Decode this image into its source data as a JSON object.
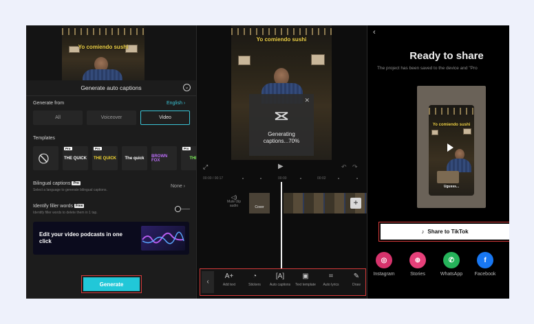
{
  "captions_panel": {
    "video_caption": "Yo comiendo sushi",
    "title": "Generate auto captions",
    "generate_from_label": "Generate from",
    "language": "English",
    "source_options": [
      "All",
      "Voiceover",
      "Video"
    ],
    "selected_source": "Video",
    "templates_label": "Templates",
    "templates": [
      {
        "text": "",
        "pro": false
      },
      {
        "text": "THE QUICK",
        "pro": true
      },
      {
        "text": "THE QUICK",
        "pro": true
      },
      {
        "text": "The quick",
        "pro": false
      },
      {
        "text": "BROWN FOX",
        "pro": false
      },
      {
        "text": "THE",
        "pro": true
      }
    ],
    "pro_badge": "Pro",
    "bilingual_label": "Bilingual captions",
    "bilingual_sub": "Select a language to generate bilingual captions.",
    "bilingual_value": "None",
    "filler_label": "Identify filler words",
    "free_badge": "Free",
    "filler_sub": "Identify filler words to delete them in 1 tap.",
    "filler_enabled": false,
    "promo_text": "Edit your video podcasts in one click",
    "generate_button": "Generate"
  },
  "editor_panel": {
    "video_caption": "Yo comiendo sushi",
    "generating_text": "Generating captions...70%",
    "generating_progress": 70,
    "time_current": "00:00",
    "time_total": "00:17",
    "tick_labels": [
      "00:00",
      "00:02"
    ],
    "mute_label": "Mute clip audio",
    "cover_label": "Cover",
    "tools": [
      {
        "icon": "add-text-icon",
        "label": "Add text"
      },
      {
        "icon": "stickers-icon",
        "label": "Stickers"
      },
      {
        "icon": "auto-captions-icon",
        "label": "Auto captions"
      },
      {
        "icon": "text-template-icon",
        "label": "Text template"
      },
      {
        "icon": "auto-lyrics-icon",
        "label": "Auto lyrics"
      },
      {
        "icon": "draw-icon",
        "label": "Draw"
      }
    ]
  },
  "share_panel": {
    "title": "Ready to share",
    "subtitle": "The project has been saved to the device and \"Pro",
    "preview_caption": "Yo comiendo sushi",
    "preview_caption_bottom": "Ugusss...",
    "share_tiktok": "Share to TikTok",
    "apps": [
      {
        "label": "Instagram",
        "icon": "instagram-icon",
        "color": "#d6336c"
      },
      {
        "label": "Stories",
        "icon": "stories-icon",
        "color": "#e6407a"
      },
      {
        "label": "WhatsApp",
        "icon": "whatsapp-icon",
        "color": "#25b35a"
      },
      {
        "label": "Facebook",
        "icon": "facebook-icon",
        "color": "#1877f2"
      }
    ]
  },
  "colors": {
    "accent": "#3bc4d6",
    "highlight_border": "#d83a3a",
    "background": "#eef1fb"
  }
}
